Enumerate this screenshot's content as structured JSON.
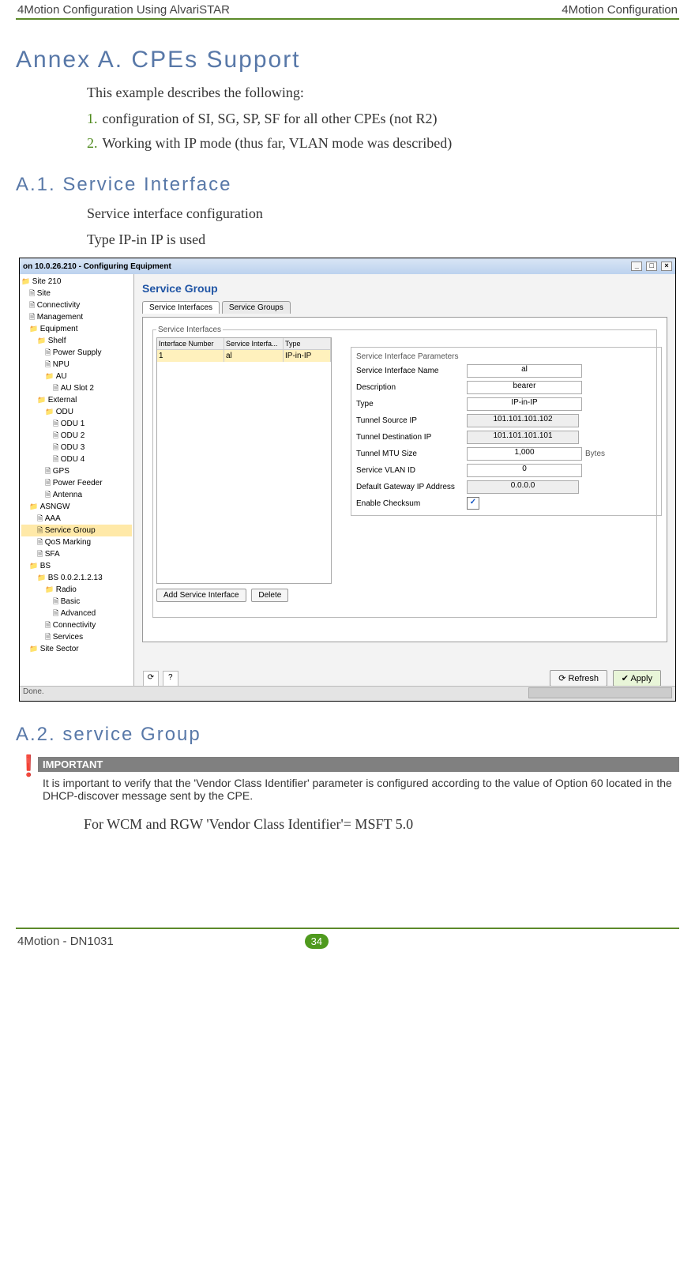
{
  "header": {
    "left": "4Motion Configuration Using AlvariSTAR",
    "right": "4Motion Configuration"
  },
  "annex": {
    "title": "Annex A.  CPEs Support",
    "intro": "This example describes the following:",
    "items": [
      "configuration of  SI, SG, SP, SF for all other CPEs (not R2)",
      "Working with IP mode (thus far, VLAN mode was described)"
    ]
  },
  "a1": {
    "title": "A.1.  Service Interface",
    "p1": "Service interface configuration",
    "p2": "Type IP-in IP is used"
  },
  "screenshot": {
    "title": "on 10.0.26.210 - Configuring Equipment",
    "tree": [
      {
        "t": "Site 210",
        "c": "folder ind0"
      },
      {
        "t": "Site",
        "c": "doc ind1"
      },
      {
        "t": "Connectivity",
        "c": "doc ind1"
      },
      {
        "t": "Management",
        "c": "doc ind1"
      },
      {
        "t": "Equipment",
        "c": "folder ind1"
      },
      {
        "t": "Shelf",
        "c": "folder ind2"
      },
      {
        "t": "Power Supply",
        "c": "doc ind3"
      },
      {
        "t": "NPU",
        "c": "doc ind3"
      },
      {
        "t": "AU",
        "c": "folder ind3"
      },
      {
        "t": "AU Slot 2",
        "c": "doc ind4"
      },
      {
        "t": "External",
        "c": "folder ind2"
      },
      {
        "t": "ODU",
        "c": "folder ind3"
      },
      {
        "t": "ODU 1",
        "c": "doc ind4"
      },
      {
        "t": "ODU 2",
        "c": "doc ind4"
      },
      {
        "t": "ODU 3",
        "c": "doc ind4"
      },
      {
        "t": "ODU 4",
        "c": "doc ind4"
      },
      {
        "t": "GPS",
        "c": "doc ind3"
      },
      {
        "t": "Power Feeder",
        "c": "doc ind3"
      },
      {
        "t": "Antenna",
        "c": "doc ind3"
      },
      {
        "t": "ASNGW",
        "c": "folder ind1"
      },
      {
        "t": "AAA",
        "c": "doc ind2"
      },
      {
        "t": "Service Group",
        "c": "doc ind2 sel"
      },
      {
        "t": "QoS Marking",
        "c": "doc ind2"
      },
      {
        "t": "SFA",
        "c": "doc ind2"
      },
      {
        "t": "BS",
        "c": "folder ind1"
      },
      {
        "t": "BS 0.0.2.1.2.13",
        "c": "folder ind2"
      },
      {
        "t": "Radio",
        "c": "folder ind3"
      },
      {
        "t": "Basic",
        "c": "doc ind4"
      },
      {
        "t": "Advanced",
        "c": "doc ind4"
      },
      {
        "t": "Connectivity",
        "c": "doc ind3"
      },
      {
        "t": "Services",
        "c": "doc ind3"
      },
      {
        "t": "Site Sector",
        "c": "folder ind1"
      }
    ],
    "panel_title": "Service Group",
    "tabs": {
      "active": "Service Interfaces",
      "other": "Service Groups"
    },
    "fieldset_label": "Service Interfaces",
    "grid": {
      "headers": [
        "Interface Number",
        "Service Interfa...",
        "Type"
      ],
      "row": [
        "1",
        "al",
        "IP-in-IP"
      ]
    },
    "buttons": {
      "add": "Add Service Interface",
      "delete": "Delete"
    },
    "params_title": "Service Interface Parameters",
    "params": [
      {
        "label": "Service Interface Name",
        "value": "al",
        "type": "text"
      },
      {
        "label": "Description",
        "value": "bearer",
        "type": "text"
      },
      {
        "label": "Type",
        "value": "IP-in-IP",
        "type": "select"
      },
      {
        "label": "Tunnel Source IP",
        "value": "101.101.101.102",
        "type": "ro"
      },
      {
        "label": "Tunnel Destination IP",
        "value": "101.101.101.101",
        "type": "ro"
      },
      {
        "label": "Tunnel MTU Size",
        "value": "1,000",
        "type": "spin",
        "unit": "Bytes"
      },
      {
        "label": "Service VLAN ID",
        "value": "0",
        "type": "spin"
      },
      {
        "label": "Default Gateway IP Address",
        "value": "0.0.0.0",
        "type": "ro"
      },
      {
        "label": "Enable Checksum",
        "value": "✓",
        "type": "check"
      }
    ],
    "bottom": {
      "refresh": "Refresh",
      "apply": "Apply"
    },
    "status": "Done."
  },
  "a2": {
    "title": "A.2.  service Group"
  },
  "important": {
    "label": "IMPORTANT",
    "text": "It is important to verify that the 'Vendor Class Identifier' parameter is configured according to the value of Option 60 located in the DHCP-discover message sent by the CPE."
  },
  "closing": "For WCM and RGW 'Vendor Class Identifier'= MSFT 5.0",
  "footer": {
    "left": "4Motion - DN1031",
    "page": "34"
  }
}
